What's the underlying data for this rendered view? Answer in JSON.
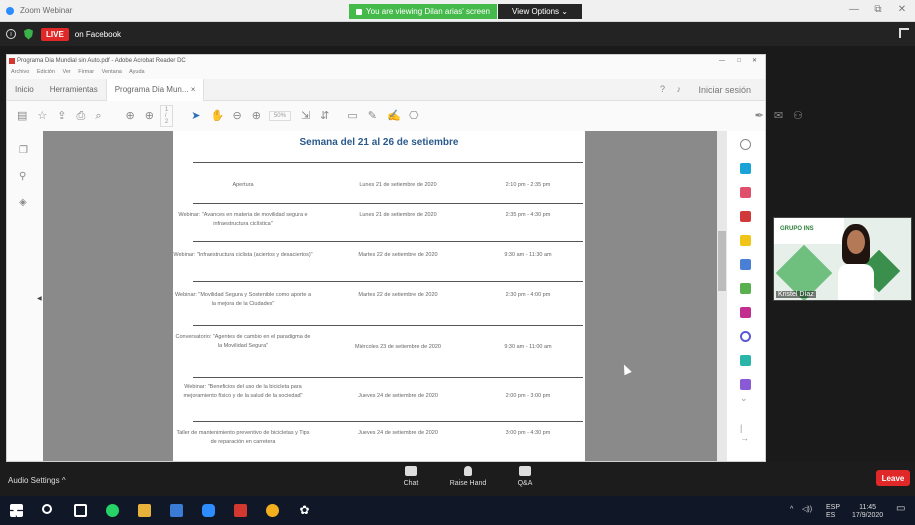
{
  "zoom": {
    "window_title": "Zoom Webinar",
    "share_banner": "You are viewing Dilan arias' screen",
    "view_options": "View Options",
    "live_badge": "LIVE",
    "live_text": "on Facebook"
  },
  "acrobat": {
    "title": "Programa Dia Mundial sin Auto.pdf - Adobe Acrobat Reader DC",
    "menu": [
      "Archivo",
      "Edición",
      "Ver",
      "Firmar",
      "Ventana",
      "Ayuda"
    ],
    "tabs": [
      "Inicio",
      "Herramientas",
      "Programa Dia Mun... ×"
    ],
    "sign_in": "Iniciar sesión",
    "pager": "1 / 2",
    "zoom_level": "50%"
  },
  "document": {
    "heading": "Semana del 21 al 26 de setiembre",
    "rows": [
      {
        "event": "Apertura",
        "date": "Lunes 21 de setiembre de 2020",
        "time": "2:10 pm - 2:35 pm"
      },
      {
        "event": "Webinar: \"Avances en materia de movilidad segura e infraestructura ciclística\"",
        "date": "Lunes 21 de setiembre de 2020",
        "time": "2:35 pm - 4:30 pm"
      },
      {
        "event": "Webinar: \"Infraestructura ciclista (aciertos y desaciertos)\"",
        "date": "Martes 22 de setiembre de 2020",
        "time": "9:30 am - 11:30 am"
      },
      {
        "event": "Webinar: \"Movilidad Segura y Sostenible como aporte a la mejora de la Ciudades\"",
        "date": "Martes 22 de setiembre de 2020",
        "time": "2:30 pm - 4:00 pm"
      },
      {
        "event": "Conversatorio: \"Agentes de cambio en el paradigma de la Movilidad Segura\"",
        "date": "Miércoles 23 de setiembre de 2020",
        "time": "9:30 am - 11:00 am"
      },
      {
        "event": "Webinar: \"Beneficios del uso de la bicicleta para mejoramiento físico y de la salud de la sociedad\"",
        "date": "Jueves 24 de setiembre de 2020",
        "time": "2:00 pm - 3:00 pm"
      },
      {
        "event": "Taller de mantenimiento preventivo de bicicletas y Tips de reparación en carretera",
        "date": "Jueves 24 de setiembre de 2020",
        "time": "3:00 pm - 4:30 pm"
      }
    ]
  },
  "video": {
    "participant_name": "Kristel Díaz",
    "logo_text": "GRUPO INS"
  },
  "bottom_bar": {
    "audio_settings": "Audio Settings",
    "chat": "Chat",
    "raise_hand": "Raise Hand",
    "qa": "Q&A",
    "leave": "Leave"
  },
  "taskbar": {
    "lang_top": "ESP",
    "lang_bottom": "ES",
    "time": "11:45",
    "date": "17/9/2020"
  },
  "colors": {
    "banner_green": "#45b94a",
    "live_red": "#e02828",
    "heading_blue": "#2a5a8c",
    "taskbar": "#101828"
  }
}
